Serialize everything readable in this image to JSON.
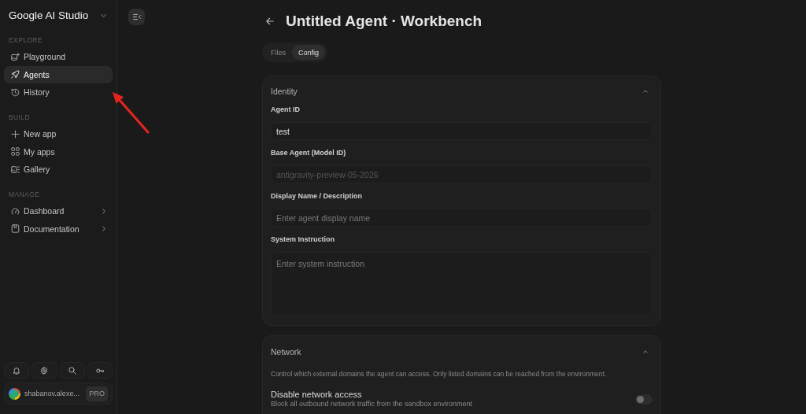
{
  "sidebar": {
    "brand": "Google AI Studio",
    "sections": [
      {
        "heading": "EXPLORE",
        "items": [
          {
            "label": "Playground",
            "kind": "link",
            "selected": false
          },
          {
            "label": "Agents",
            "kind": "link",
            "selected": true
          },
          {
            "label": "History",
            "kind": "link",
            "selected": false
          }
        ]
      },
      {
        "heading": "BUILD",
        "items": [
          {
            "label": "New app",
            "kind": "link",
            "selected": false
          },
          {
            "label": "My apps",
            "kind": "link",
            "selected": false
          },
          {
            "label": "Gallery",
            "kind": "link",
            "selected": false
          }
        ]
      },
      {
        "heading": "MANAGE",
        "items": [
          {
            "label": "Dashboard",
            "kind": "submenu",
            "selected": false
          },
          {
            "label": "Documentation",
            "kind": "submenu",
            "selected": false
          }
        ]
      }
    ],
    "account": {
      "name": "shabanov.alexe...",
      "plan": "PRO"
    }
  },
  "header": {
    "title": "Untitled Agent · Workbench",
    "tabs": [
      {
        "label": "Files",
        "selected": false
      },
      {
        "label": "Config",
        "selected": true
      }
    ]
  },
  "sections": [
    {
      "title": "Identity",
      "expanded": true,
      "fields": [
        {
          "label": "Agent ID",
          "kind": "input",
          "value": "test",
          "disabled": false
        },
        {
          "label": "Base Agent (Model ID)",
          "kind": "input",
          "value": "antigravity-preview-05-2026",
          "disabled": true
        },
        {
          "label": "Display Name / Description",
          "kind": "input",
          "placeholder": "Enter agent display name",
          "disabled": false
        },
        {
          "label": "System Instruction",
          "kind": "textarea",
          "placeholder": "Enter system instruction",
          "disabled": false
        }
      ]
    },
    {
      "title": "Network",
      "expanded": true,
      "description": "Control which external domains the agent can access. Only listed domains can be reached from the environment.",
      "toggles": [
        {
          "label": "Disable network access",
          "description": "Block all outbound network traffic from the sandbox environment",
          "on": false
        }
      ]
    }
  ]
}
